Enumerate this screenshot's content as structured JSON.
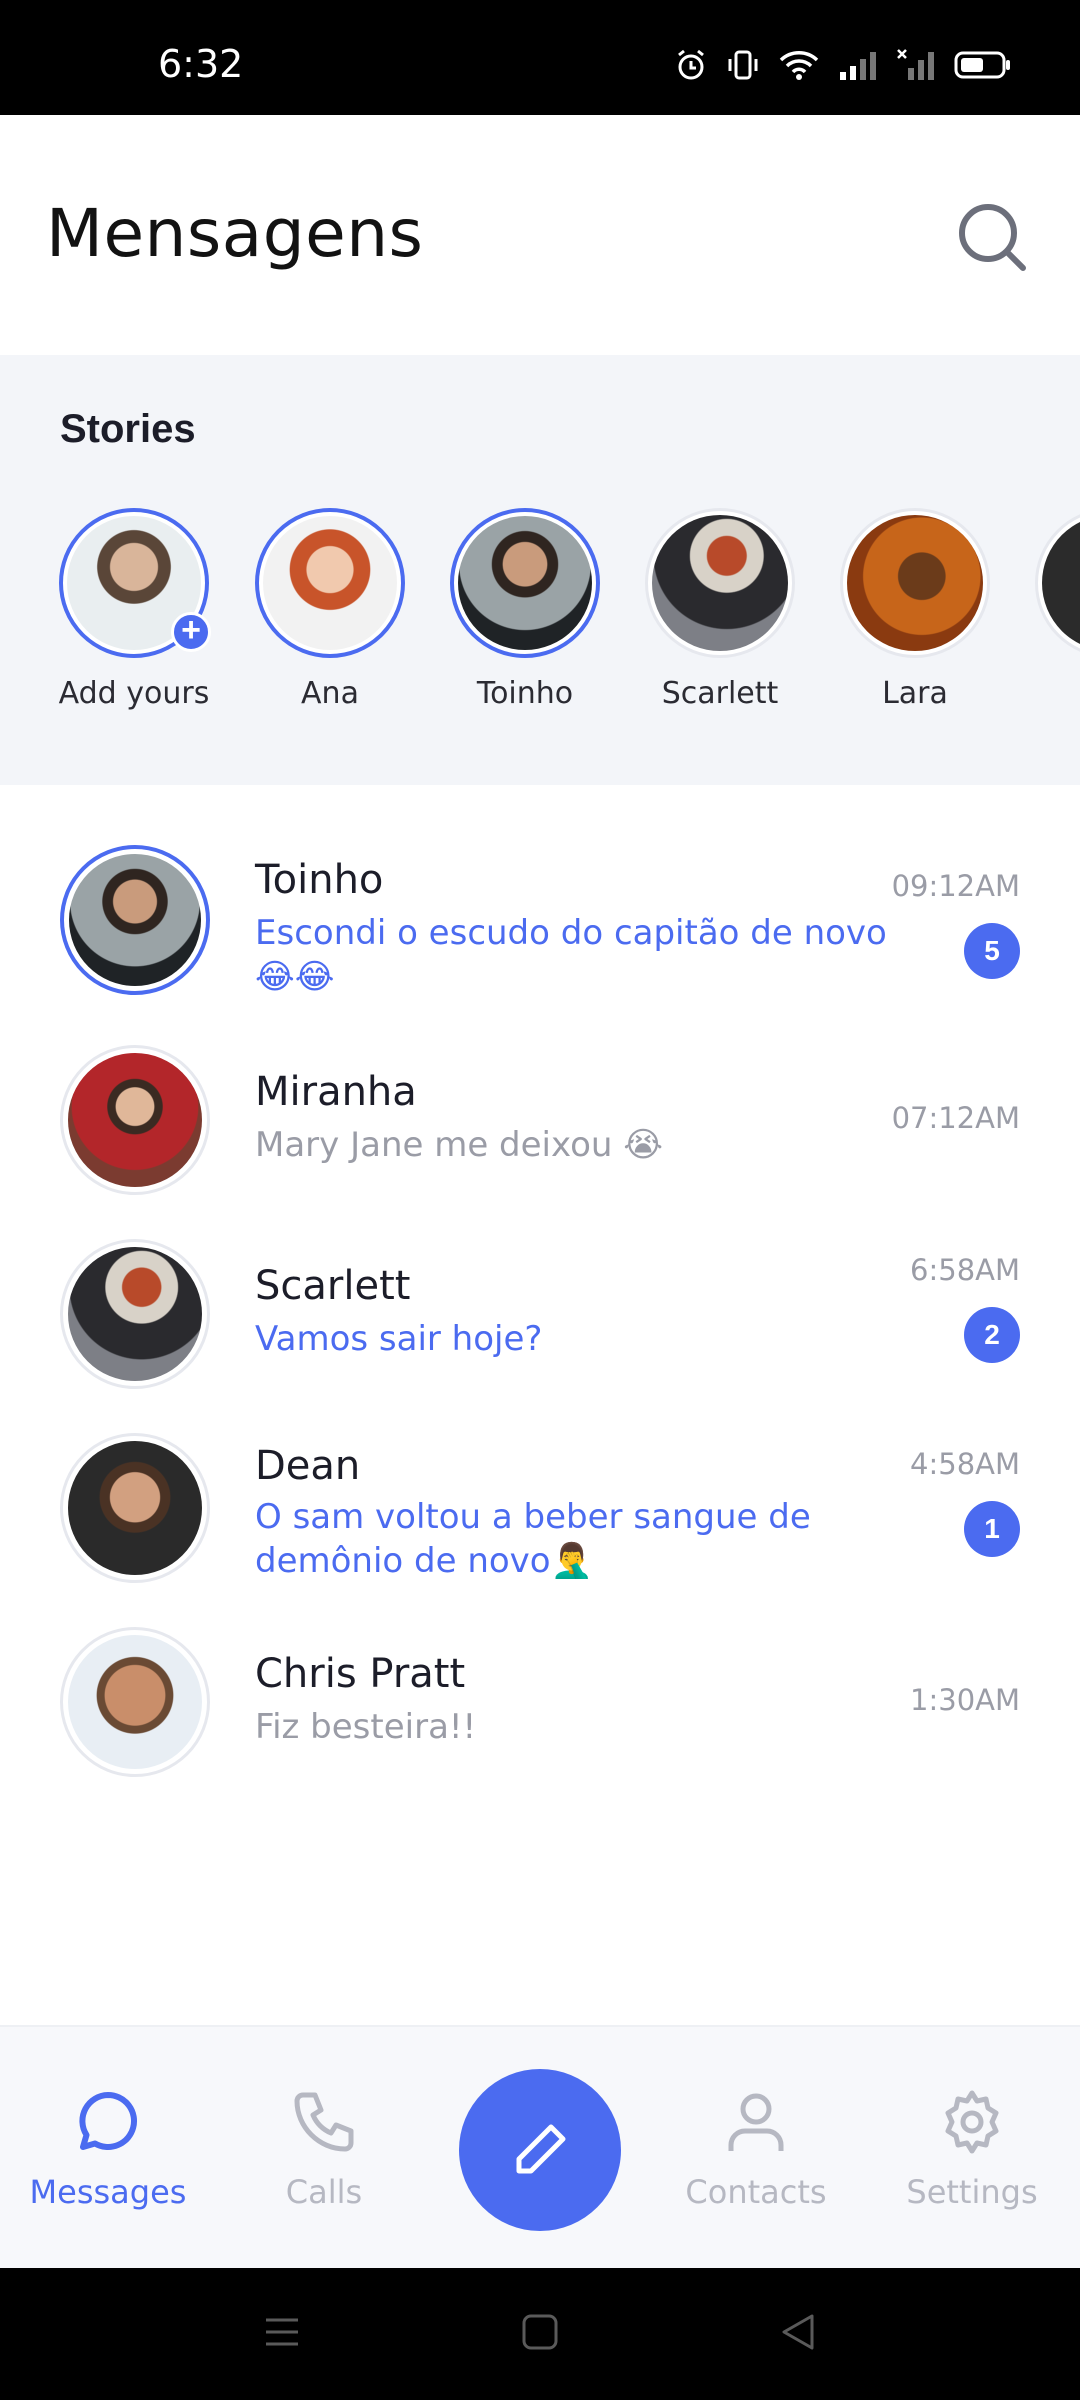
{
  "status_bar": {
    "time": "6:32"
  },
  "header": {
    "title": "Mensagens"
  },
  "stories": {
    "title": "Stories",
    "items": [
      {
        "name": "Add yours",
        "ring": "active",
        "add": "+"
      },
      {
        "name": "Ana",
        "ring": "active"
      },
      {
        "name": "Toinho",
        "ring": "active"
      },
      {
        "name": "Scarlett",
        "ring": "seen"
      },
      {
        "name": "Lara",
        "ring": "seen"
      }
    ]
  },
  "chats": [
    {
      "name": "Toinho",
      "message": "Escondi o escudo do capitão de novo 😂😂",
      "time": "09:12AM",
      "unread": "5",
      "status": "unread"
    },
    {
      "name": "Miranha",
      "message": "Mary Jane me deixou 😭",
      "time": "07:12AM",
      "unread": "",
      "status": "read"
    },
    {
      "name": "Scarlett",
      "message": "Vamos sair hoje?",
      "time": "6:58AM",
      "unread": "2",
      "status": "unread"
    },
    {
      "name": "Dean",
      "message": "O sam voltou a beber sangue de demônio de novo🤦‍♂️",
      "time": "4:58AM",
      "unread": "1",
      "status": "unread"
    },
    {
      "name": "Chris Pratt",
      "message": "Fiz besteira!!",
      "time": "1:30AM",
      "unread": "",
      "status": "read"
    }
  ],
  "nav": {
    "messages": "Messages",
    "calls": "Calls",
    "contacts": "Contacts",
    "settings": "Settings",
    "active": "messages"
  },
  "colors": {
    "accent": "#4b6bf0",
    "muted": "#9a9ca6",
    "stories_bg": "#f3f5f9"
  }
}
